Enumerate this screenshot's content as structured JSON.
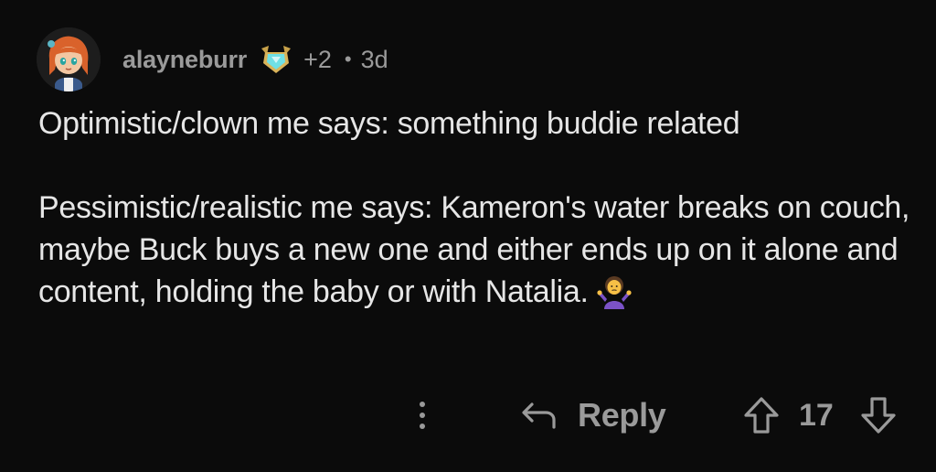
{
  "comment": {
    "username": "alayneburr",
    "award_count": "+2",
    "separator": "•",
    "age": "3d",
    "paragraphs": [
      "Optimistic/clown me says: something buddie related",
      "Pessimistic/realistic me says: Kameron's water breaks on couch, maybe Buck buys a new one and either ends up on it alone and content, holding the baby or with Natalia."
    ],
    "emoji_icon": "person-shrugging-emoji"
  },
  "actions": {
    "more_icon": "vertical-ellipsis-icon",
    "reply_icon": "reply-arrow-icon",
    "reply_label": "Reply",
    "upvote_icon": "upvote-arrow-icon",
    "vote_count": "17",
    "downvote_icon": "downvote-arrow-icon"
  },
  "colors": {
    "background": "#0b0b0b",
    "text_primary": "#e6e6e6",
    "text_secondary": "#9a9a9a"
  }
}
